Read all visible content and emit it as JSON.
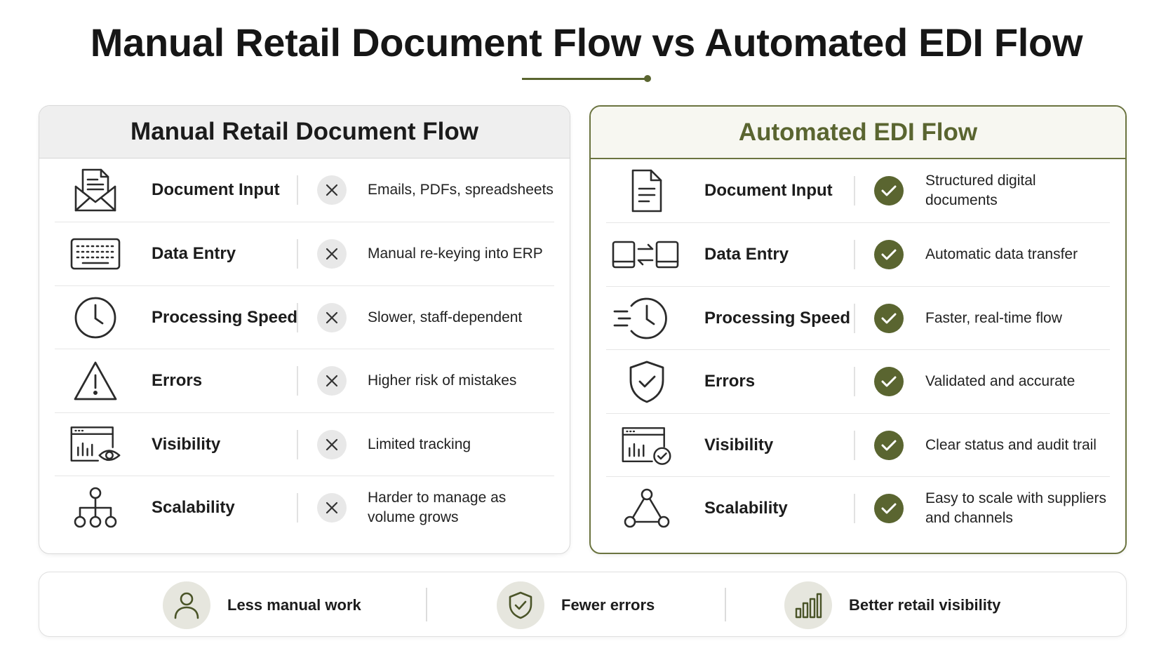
{
  "title": "Manual Retail Document Flow vs Automated EDI Flow",
  "colors": {
    "accent": "#5a6530",
    "panel_header_manual": "#efefef",
    "mark_manual": "#e8e8e8"
  },
  "manual": {
    "heading": "Manual Retail Document Flow",
    "rows": [
      {
        "label": "Document Input",
        "desc": "Emails, PDFs, spreadsheets",
        "icon": "envelope-document-icon"
      },
      {
        "label": "Data Entry",
        "desc": "Manual re-keying into ERP",
        "icon": "keyboard-icon"
      },
      {
        "label": "Processing Speed",
        "desc": "Slower, staff-dependent",
        "icon": "clock-icon"
      },
      {
        "label": "Errors",
        "desc": "Higher risk of mistakes",
        "icon": "warning-triangle-icon"
      },
      {
        "label": "Visibility",
        "desc": "Limited tracking",
        "icon": "dashboard-eye-icon"
      },
      {
        "label": "Scalability",
        "desc_line1": "Harder to manage as",
        "desc_line2": "volume grows",
        "icon": "hierarchy-icon"
      }
    ]
  },
  "auto": {
    "heading": "Automated EDI Flow",
    "rows": [
      {
        "label": "Document Input",
        "desc": "Structured digital documents",
        "icon": "document-icon"
      },
      {
        "label": "Data Entry",
        "desc": "Automatic data transfer",
        "icon": "devices-transfer-icon"
      },
      {
        "label": "Processing Speed",
        "desc": "Faster, real-time flow",
        "icon": "fast-clock-icon"
      },
      {
        "label": "Errors",
        "desc": "Validated and accurate",
        "icon": "shield-check-icon"
      },
      {
        "label": "Visibility",
        "desc": "Clear status and audit trail",
        "icon": "dashboard-check-icon"
      },
      {
        "label": "Scalability",
        "desc_line1": "Easy to scale with suppliers",
        "desc_line2": "and channels",
        "icon": "network-triangle-icon"
      }
    ]
  },
  "benefits": [
    {
      "label": "Less manual work",
      "icon": "person-icon"
    },
    {
      "label": "Fewer errors",
      "icon": "shield-check-icon"
    },
    {
      "label": "Better retail visibility",
      "icon": "bar-chart-icon"
    }
  ]
}
